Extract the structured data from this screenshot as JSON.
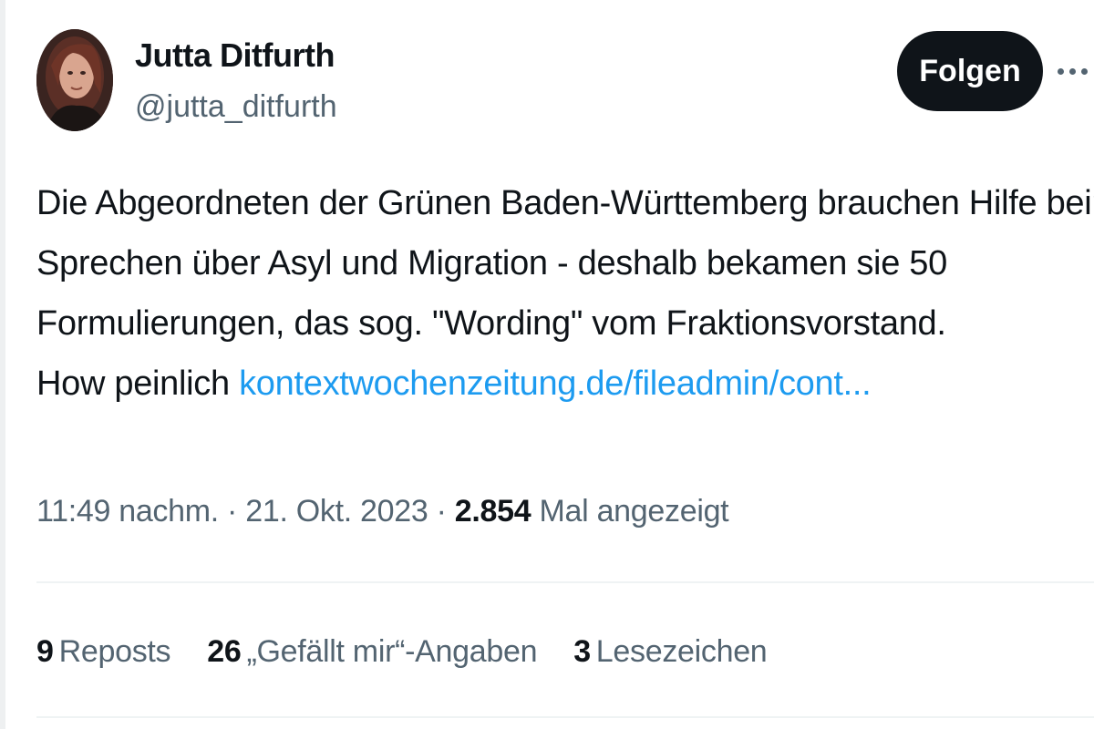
{
  "author": {
    "name": "Jutta Ditfurth",
    "handle": "@jutta_ditfurth"
  },
  "header": {
    "follow_label": "Folgen",
    "more_icon": "more-horizontal-icon"
  },
  "tweet": {
    "lines": [
      "Die Abgeordneten der Grünen Baden-Württemberg brauchen Hilfe beim",
      "Sprechen über Asyl und Migration - deshalb bekamen sie 50",
      "Formulierungen, das sog. \"Wording\" vom Fraktionsvorstand."
    ],
    "last_line_text": "How peinlich ",
    "link_text": "kontextwochenzeitung.de/fileadmin/cont..."
  },
  "meta": {
    "time": "11:49 nachm.",
    "separator": " · ",
    "date": "21. Okt. 2023",
    "views_count": "2.854",
    "views_label": " Mal angezeigt"
  },
  "stats": {
    "reposts_count": "9",
    "reposts_label": "Reposts",
    "likes_count": "26",
    "likes_label": "„Gefällt mir“-Angaben",
    "bookmarks_count": "3",
    "bookmarks_label": "Lesezeichen"
  },
  "colors": {
    "text_primary": "#0f1419",
    "text_secondary": "#536471",
    "link": "#1d9bf0",
    "button_bg": "#0f1419",
    "divider": "#eff3f4"
  }
}
